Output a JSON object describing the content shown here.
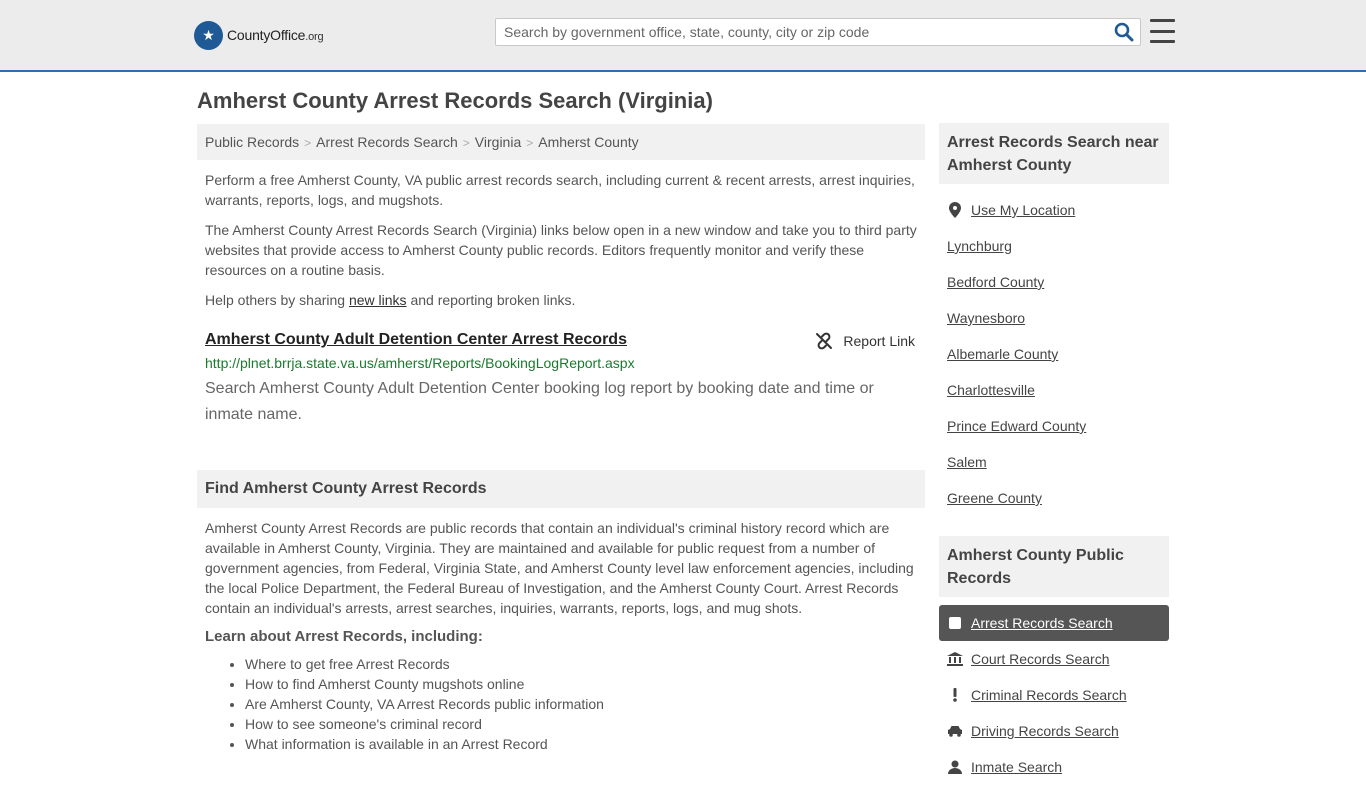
{
  "header": {
    "logo_main": "CountyOffice",
    "logo_tld": ".org",
    "search_placeholder": "Search by government office, state, county, city or zip code"
  },
  "page_title": "Amherst County Arrest Records Search (Virginia)",
  "breadcrumb": [
    "Public Records",
    "Arrest Records Search",
    "Virginia",
    "Amherst County"
  ],
  "intro": {
    "p1": "Perform a free Amherst County, VA public arrest records search, including current & recent arrests, arrest inquiries, warrants, reports, logs, and mugshots.",
    "p2": "The Amherst County Arrest Records Search (Virginia) links below open in a new window and take you to third party websites that provide access to Amherst County public records. Editors frequently monitor and verify these resources on a routine basis.",
    "p3_before": "Help others by sharing ",
    "p3_link": "new links",
    "p3_after": " and reporting broken links."
  },
  "record": {
    "title": "Amherst County Adult Detention Center Arrest Records",
    "report_label": "Report Link",
    "url": "http://plnet.brrja.state.va.us/amherst/Reports/BookingLogReport.aspx",
    "description": "Search Amherst County Adult Detention Center booking log report by booking date and time or inmate name."
  },
  "find_section": {
    "heading": "Find Amherst County Arrest Records",
    "body": "Amherst County Arrest Records are public records that contain an individual's criminal history record which are available in Amherst County, Virginia. They are maintained and available for public request from a number of government agencies, from Federal, Virginia State, and Amherst County level law enforcement agencies, including the local Police Department, the Federal Bureau of Investigation, and the Amherst County Court. Arrest Records contain an individual's arrests, arrest searches, inquiries, warrants, reports, logs, and mug shots.",
    "learn_heading": "Learn about Arrest Records, including:",
    "learn_items": [
      "Where to get free Arrest Records",
      "How to find Amherst County mugshots online",
      "Are Amherst County, VA Arrest Records public information",
      "How to see someone's criminal record",
      "What information is available in an Arrest Record"
    ]
  },
  "sidebar": {
    "near_heading": "Arrest Records Search near Amherst County",
    "use_location": "Use My Location",
    "near_items": [
      "Lynchburg",
      "Bedford County",
      "Waynesboro",
      "Albemarle County",
      "Charlottesville",
      "Prince Edward County",
      "Salem",
      "Greene County"
    ],
    "public_heading": "Amherst County Public Records",
    "public_items": [
      {
        "label": "Arrest Records Search",
        "icon": "square-icon",
        "active": true
      },
      {
        "label": "Court Records Search",
        "icon": "courthouse-icon",
        "active": false
      },
      {
        "label": "Criminal Records Search",
        "icon": "exclamation-icon",
        "active": false
      },
      {
        "label": "Driving Records Search",
        "icon": "car-icon",
        "active": false
      },
      {
        "label": "Inmate Search",
        "icon": "user-icon",
        "active": false
      }
    ]
  }
}
